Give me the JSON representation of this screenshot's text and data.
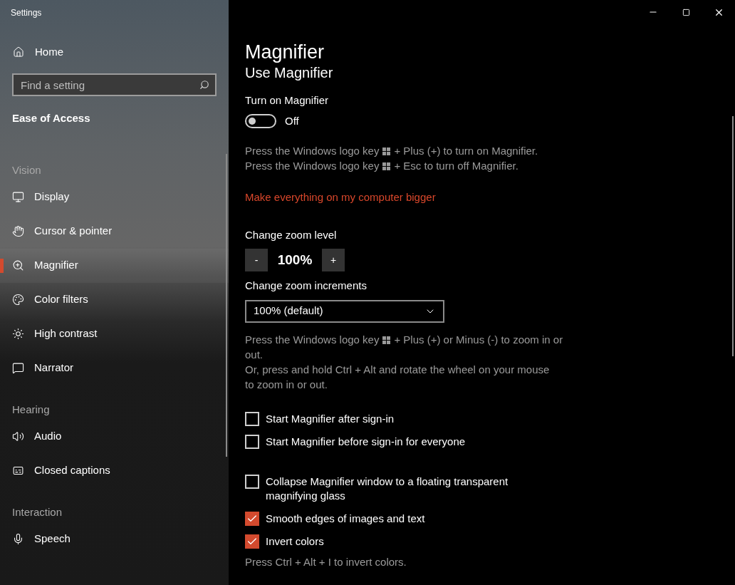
{
  "window": {
    "title": "Settings"
  },
  "sidebar": {
    "home": "Home",
    "search": {
      "placeholder": "Find a setting"
    },
    "section_title": "Ease of Access",
    "groups": [
      {
        "heading": "Vision",
        "items": [
          {
            "label": "Display",
            "selected": false
          },
          {
            "label": "Cursor & pointer",
            "selected": false
          },
          {
            "label": "Magnifier",
            "selected": true
          },
          {
            "label": "Color filters",
            "selected": false
          },
          {
            "label": "High contrast",
            "selected": false
          },
          {
            "label": "Narrator",
            "selected": false
          }
        ]
      },
      {
        "heading": "Hearing",
        "items": [
          {
            "label": "Audio",
            "selected": false
          },
          {
            "label": "Closed captions",
            "selected": false
          }
        ]
      },
      {
        "heading": "Interaction",
        "items": [
          {
            "label": "Speech",
            "selected": false
          }
        ]
      }
    ]
  },
  "page": {
    "title": "Magnifier",
    "subtitle": "Use Magnifier",
    "toggle": {
      "label": "Turn on Magnifier",
      "on": false,
      "state_text": "Off"
    },
    "shortcut_hints": [
      {
        "parts": [
          "Press the Windows logo key",
          "+ Plus (+) to turn on Magnifier."
        ]
      },
      {
        "parts": [
          "Press the Windows logo key",
          "+ Esc to turn off Magnifier."
        ]
      }
    ],
    "link": "Make everything on my computer bigger",
    "zoom": {
      "label": "Change zoom level",
      "decrease": "-",
      "value": "100%",
      "increase": "+"
    },
    "increments": {
      "label": "Change zoom increments",
      "value": "100% (default)"
    },
    "zoom_hints": [
      {
        "parts": [
          "Press the Windows logo key",
          "+ Plus (+) or Minus (-) to zoom in or"
        ]
      },
      {
        "parts": [
          "out."
        ]
      },
      {
        "parts": [
          "Or, press and hold Ctrl + Alt and rotate the wheel on your mouse"
        ]
      },
      {
        "parts": [
          "to zoom in or out."
        ]
      }
    ],
    "startup_options": [
      {
        "label": "Start Magnifier after sign-in",
        "checked": false
      },
      {
        "label": "Start Magnifier before sign-in for everyone",
        "checked": false
      }
    ],
    "view_options": [
      {
        "label": "Collapse Magnifier window to a floating transparent magnifying glass",
        "checked": false
      },
      {
        "label": "Smooth edges of images and text",
        "checked": true
      },
      {
        "label": "Invert colors",
        "checked": true
      }
    ],
    "invert_hint": "Press Ctrl + Alt + I to invert colors."
  }
}
